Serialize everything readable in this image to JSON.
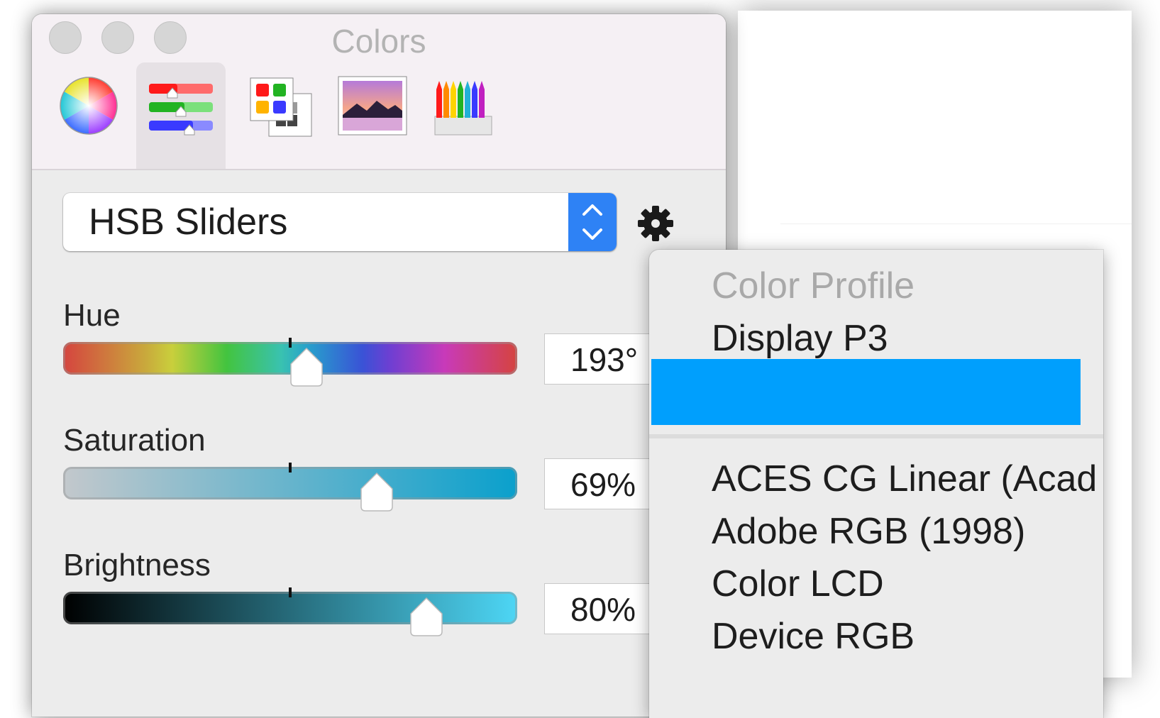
{
  "window": {
    "title": "Colors"
  },
  "traffic_lights": [
    "close-button",
    "minimize-button",
    "zoom-button"
  ],
  "mode_tabs": [
    {
      "name": "color-wheel",
      "icon": "color-wheel-icon",
      "selected": false
    },
    {
      "name": "color-sliders",
      "icon": "sliders-icon",
      "selected": true
    },
    {
      "name": "color-palettes",
      "icon": "palettes-icon",
      "selected": false
    },
    {
      "name": "image-palettes",
      "icon": "image-palette-icon",
      "selected": false
    },
    {
      "name": "pencils",
      "icon": "pencils-icon",
      "selected": false
    }
  ],
  "slider_mode": {
    "selected": "HSB Sliders",
    "action_icon": "gear-icon"
  },
  "sliders": [
    {
      "label": "Hue",
      "value": "193°",
      "fraction": 0.536
    },
    {
      "label": "Saturation",
      "value": "69%",
      "fraction": 0.69
    },
    {
      "label": "Brightness",
      "value": "80%",
      "fraction": 0.8
    }
  ],
  "menu": {
    "header": "Color Profile",
    "items": [
      "Display P3",
      "",
      "ACES CG Linear (Acad",
      "Adobe RGB (1998)",
      "Color LCD",
      "Device RGB"
    ],
    "highlighted_index": 1,
    "highlight_color": "#009ffd"
  },
  "colors": {
    "accent": "#2e82f5",
    "current_color": "#3fa4c8"
  }
}
